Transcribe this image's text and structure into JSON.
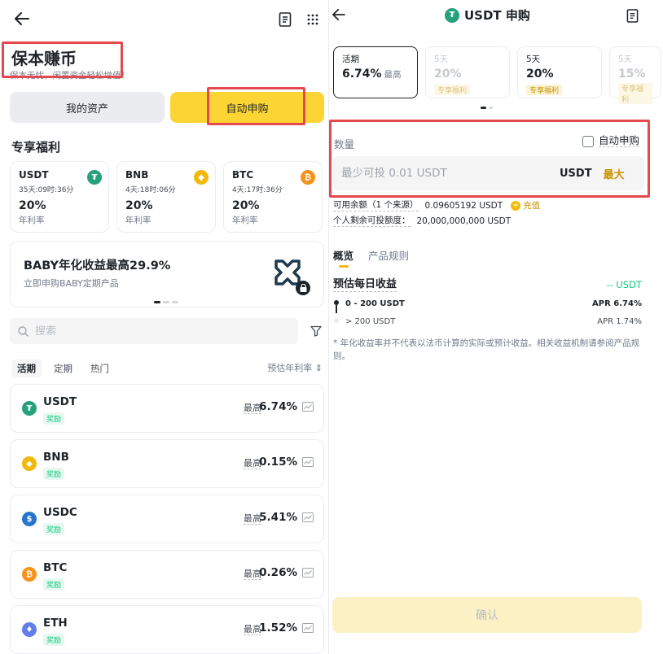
{
  "left": {
    "hero": {
      "title": "保本赚币",
      "subtitle": "保本无忧，闲置资金轻松增值！"
    },
    "tabs": {
      "assets": "我的资产",
      "auto": "自动申购"
    },
    "section_title": "专享福利",
    "promos": [
      {
        "coin": "USDT",
        "time": "35天:09时:36分",
        "rate": "20%",
        "label": "年利率",
        "icon": "tether-icon",
        "color": "#26a17b",
        "glyph": "₮"
      },
      {
        "coin": "BNB",
        "time": "4天:18时:06分",
        "rate": "20%",
        "label": "年利率",
        "icon": "bnb-icon",
        "color": "#f0b90b",
        "glyph": "◆"
      },
      {
        "coin": "BTC",
        "time": "4天:17时:36分",
        "rate": "20%",
        "label": "年利率",
        "icon": "bitcoin-icon",
        "color": "#f7931a",
        "glyph": "₿"
      }
    ],
    "banner": {
      "title": "BABY年化收益最高29.9%",
      "subtitle": "立即申购BABY定期产品"
    },
    "search": {
      "placeholder": "搜索"
    },
    "filter_tabs": [
      "活期",
      "定期",
      "热门"
    ],
    "sort_label": "预估年利率",
    "products": [
      {
        "coin": "USDT",
        "badge": "奖励",
        "max_label": "最高",
        "apr": "6.74%",
        "icon": "tether-icon",
        "color": "#26a17b",
        "glyph": "₮"
      },
      {
        "coin": "BNB",
        "badge": "奖励",
        "max_label": "最高",
        "apr": "0.15%",
        "icon": "bnb-icon",
        "color": "#f0b90b",
        "glyph": "◆"
      },
      {
        "coin": "USDC",
        "badge": "奖励",
        "max_label": "最高",
        "apr": "5.41%",
        "icon": "usdc-icon",
        "color": "#2775ca",
        "glyph": "$"
      },
      {
        "coin": "BTC",
        "badge": "奖励",
        "max_label": "最高",
        "apr": "0.26%",
        "icon": "bitcoin-icon",
        "color": "#f7931a",
        "glyph": "₿"
      },
      {
        "coin": "ETH",
        "badge": "奖励",
        "max_label": "最高",
        "apr": "1.52%",
        "icon": "ethereum-icon",
        "color": "#627eea",
        "glyph": "♦"
      }
    ]
  },
  "right": {
    "title": "USDT 申购",
    "terms": [
      {
        "name": "活期",
        "apr": "6.74%",
        "suffix": "最高",
        "tag": ""
      },
      {
        "name": "5天",
        "apr": "20%",
        "suffix": "",
        "tag": "专享福利"
      },
      {
        "name": "5天",
        "apr": "20%",
        "suffix": "",
        "tag": "专享福利"
      },
      {
        "name": "5天",
        "apr": "15%",
        "suffix": "",
        "tag": "专享福利"
      }
    ],
    "quantity_label": "数量",
    "auto_subscribe": "自动申购",
    "amount": {
      "placeholder": "最少可投 0.01 USDT",
      "unit": "USDT",
      "max": "最大"
    },
    "available": {
      "label": "可用余额（1 个来源）",
      "value": "0.09605192 USDT",
      "recharge": "充值"
    },
    "remaining": {
      "label": "个人剩余可投额度：",
      "value": "20,000,000,000 USDT"
    },
    "tabs": [
      "概览",
      "产品规则"
    ],
    "estimate": {
      "title": "预估每日收益",
      "value": "-- USDT"
    },
    "tiers": [
      {
        "range": "0 - 200 USDT",
        "apr": "APR 6.74%"
      },
      {
        "range": "> 200 USDT",
        "apr": "APR 1.74%"
      }
    ],
    "note": "* 年化收益率并不代表以法币计算的实际或预计收益。相关收益机制请参阅产品规则。",
    "confirm": "确认"
  }
}
